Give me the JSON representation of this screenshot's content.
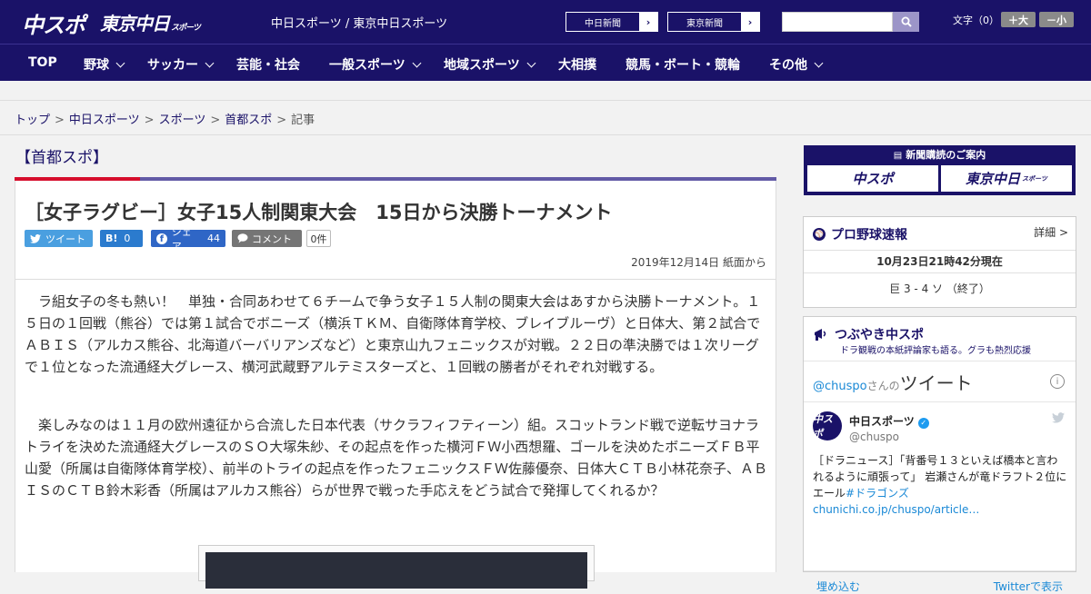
{
  "header": {
    "logo_chunichi_sports": "中スポ",
    "logo_tokyo_chunichi": "東京中日",
    "logo_tokyo_chunichi_sub": "スポーツ",
    "site_name": "中日スポーツ / 東京中日スポーツ",
    "papers": [
      {
        "label": "中日新聞"
      },
      {
        "label": "東京新聞"
      }
    ],
    "search": {
      "placeholder": ""
    },
    "font_size_label": "文字（0）",
    "font_larger": "＋大",
    "font_smaller": "－小"
  },
  "nav": {
    "items": [
      {
        "label": "TOP",
        "dropdown": false
      },
      {
        "label": "野球",
        "dropdown": true
      },
      {
        "label": "サッカー",
        "dropdown": true
      },
      {
        "label": "芸能・社会",
        "dropdown": false
      },
      {
        "label": "一般スポーツ",
        "dropdown": true
      },
      {
        "label": "地域スポーツ",
        "dropdown": true
      },
      {
        "label": "大相撲",
        "dropdown": false
      },
      {
        "label": "競馬・ボート・競輪",
        "dropdown": false
      },
      {
        "label": "その他",
        "dropdown": true
      }
    ]
  },
  "breadcrumb": {
    "items": [
      "トップ",
      "中日スポーツ",
      "スポーツ",
      "首都スポ"
    ],
    "current": "記事",
    "separator": ">"
  },
  "article": {
    "category": "【首都スポ】",
    "headline": "［女子ラグビー］女子15人制関東大会　15日から決勝トーナメント",
    "share": {
      "tweet": "ツイート",
      "hatena_count": "0",
      "facebook": "シェア",
      "facebook_count": "44",
      "comment": "コメント",
      "comment_count": "0件"
    },
    "date": "2019年12月14日 紙面から",
    "paragraphs": [
      "　ラ組女子の冬も熱い！　単独・合同あわせて６チームで争う女子１５人制の関東大会はあすから決勝トーナメント。１５日の１回戦（熊谷）では第１試合でボニーズ（横浜ＴＫＭ、自衛隊体育学校、ブレイブルーヴ）と日体大、第２試合でＡＢＩＳ（アルカス熊谷、北海道バーバリアンズなど）と東京山九フェニックスが対戦。２２日の準決勝では１次リーグで１位となった流通経大グレース、横河武蔵野アルテミスターズと、１回戦の勝者がそれぞれ対戦する。",
      "　楽しみなのは１１月の欧州遠征から合流した日本代表（サクラフィフティーン）組。スコットランド戦で逆転サヨナラトライを決めた流通経大グレースのＳＯ大塚朱紗、その起点を作った横河ＦＷ小西想羅、ゴールを決めたボニーズＦＢ平山愛（所属は自衛隊体育学校）、前半のトライの起点を作ったフェニックスＦＷ佐藤優奈、日体大ＣＴＢ小林花奈子、ＡＢＩＳのＣＴＢ鈴木彩香（所属はアルカス熊谷）らが世界で戦った手応えをどう試合で発揮してくれるか？"
    ]
  },
  "sidebar": {
    "subscription": {
      "title": "新聞購読のご案内",
      "box1": "中スポ",
      "box2": "東京中日",
      "box2_sub": "スポーツ"
    },
    "baseball": {
      "title": "プロ野球速報",
      "more": "詳細 >",
      "updated": "10月23日21時42分現在",
      "game": "巨 3 - 4 ソ （終了）"
    },
    "twitter": {
      "title": "つぶやき中スポ",
      "subtitle": "ドラ観戦の本紙評論家も語る。グラも熱烈応援",
      "handle_link": "@chuspo",
      "san": "さんの",
      "tweets_label": "ツイート",
      "info": "i",
      "avatar_text": "中スポ",
      "account_name": "中日スポーツ",
      "account_handle": "@chuspo",
      "tweet_text": "［ドラニュース］「背番号１３といえば橋本と言われるように頑張って」 岩瀬さんが竜ドラフト２位にエール",
      "tweet_hashtag": "#ドラゴンズ",
      "tweet_link": "chunichi.co.jp/chuspo/article…",
      "embed": "埋め込む",
      "view_on": "Twitterで表示"
    }
  },
  "colors": {
    "brand_navy": "#1a1268",
    "accent_red": "#d60d2c",
    "accent_purple": "#625aa6",
    "twitter_blue": "#4a9fe0"
  }
}
